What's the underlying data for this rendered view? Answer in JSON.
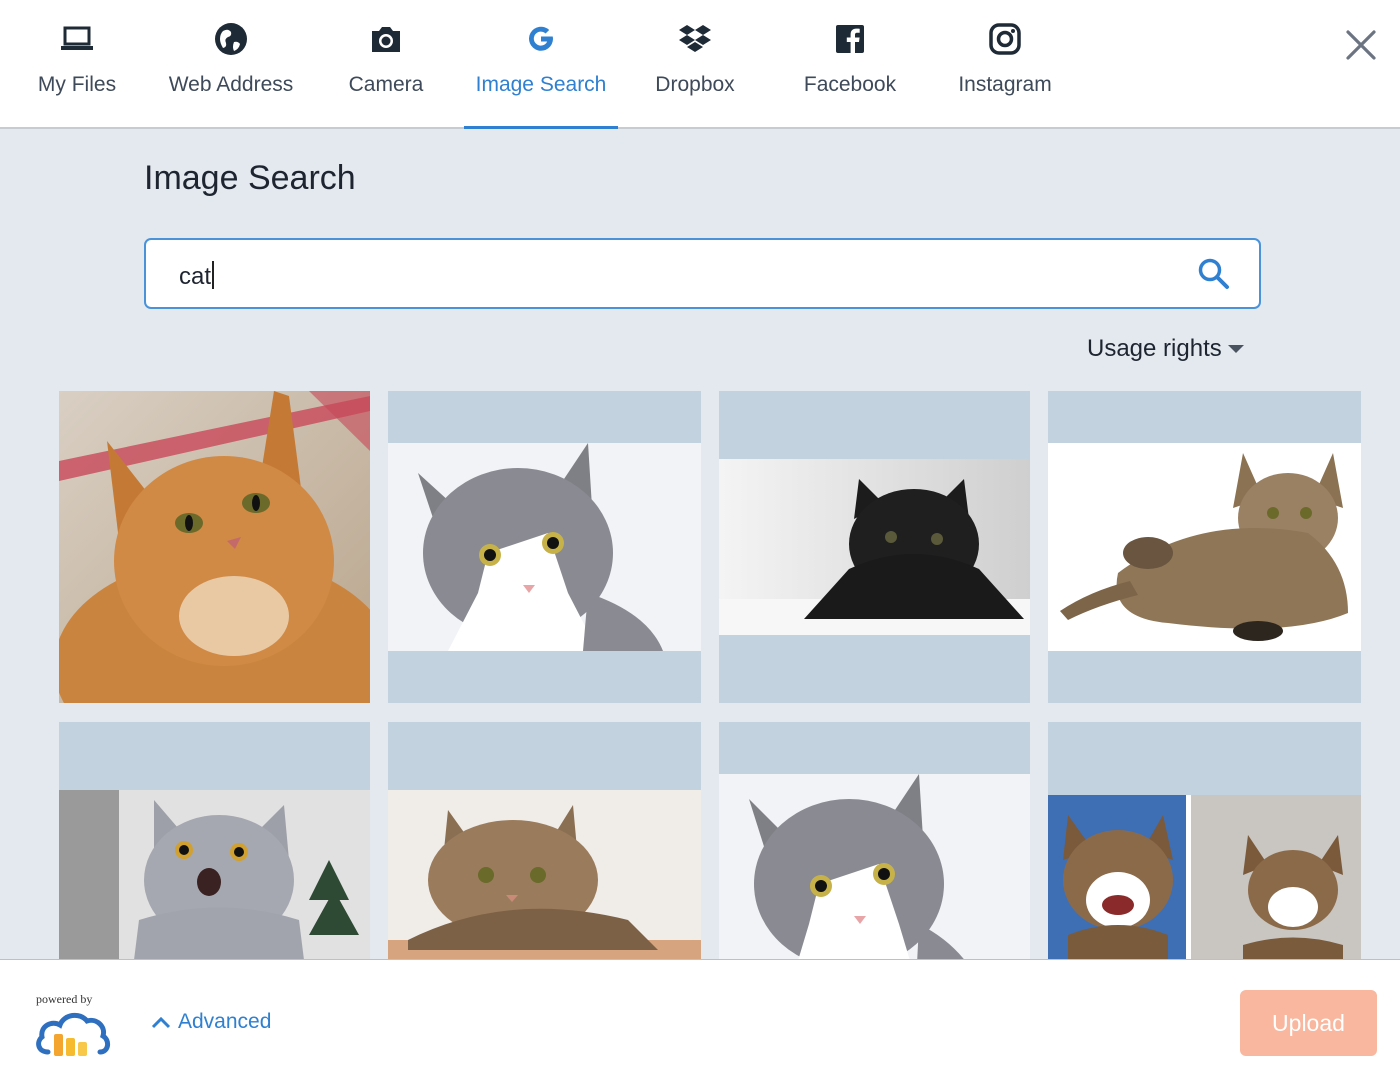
{
  "tabs": [
    {
      "label": "My Files",
      "icon": "laptop-icon"
    },
    {
      "label": "Web Address",
      "icon": "globe-icon"
    },
    {
      "label": "Camera",
      "icon": "camera-icon"
    },
    {
      "label": "Image Search",
      "icon": "google-icon",
      "active": true
    },
    {
      "label": "Dropbox",
      "icon": "dropbox-icon"
    },
    {
      "label": "Facebook",
      "icon": "facebook-icon"
    },
    {
      "label": "Instagram",
      "icon": "instagram-icon"
    }
  ],
  "close_icon": "close-icon",
  "main": {
    "title": "Image Search",
    "search": {
      "value": "cat",
      "icon": "search-icon"
    },
    "usage_rights_label": "Usage rights"
  },
  "results": [
    {
      "subject": "orange tabby cat"
    },
    {
      "subject": "grey and white cat"
    },
    {
      "subject": "black cat on bed"
    },
    {
      "subject": "lying tabby cat"
    },
    {
      "subject": "startled grey cat"
    },
    {
      "subject": "resting tabby cat"
    },
    {
      "subject": "grey and white cat"
    },
    {
      "subject": "two laughing cats"
    }
  ],
  "footer": {
    "powered_by": "powered by",
    "logo_icon": "cloudinary-logo",
    "advanced_label": "Advanced",
    "upload_label": "Upload"
  },
  "colors": {
    "accent": "#2f80d0",
    "panel_bg": "#e4e9ef",
    "tile_placeholder": "#c2d2df",
    "upload_disabled": "#f8b79e"
  }
}
